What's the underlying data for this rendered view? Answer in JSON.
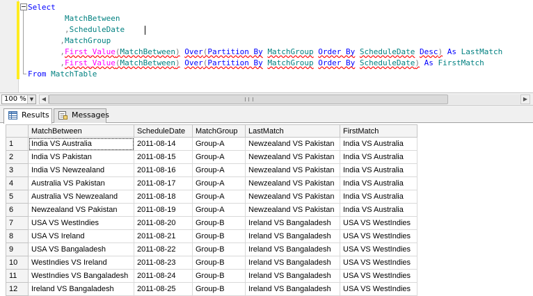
{
  "editor": {
    "lines": [
      [
        {
          "t": "Select",
          "c": "kw"
        }
      ],
      [
        {
          "t": "        "
        },
        {
          "t": "MatchBetween",
          "c": "id"
        }
      ],
      [
        {
          "t": "        "
        },
        {
          "t": ",",
          "c": "gray"
        },
        {
          "t": "ScheduleDate",
          "c": "id"
        }
      ],
      [
        {
          "t": "       "
        },
        {
          "t": ",",
          "c": "gray"
        },
        {
          "t": "MatchGroup",
          "c": "id"
        }
      ],
      [
        {
          "t": "       "
        },
        {
          "t": ",",
          "c": "gray"
        },
        {
          "t": "First_Value",
          "c": "fn sq"
        },
        {
          "t": "(",
          "c": "gray sq"
        },
        {
          "t": "MatchBetween",
          "c": "id sq"
        },
        {
          "t": ")",
          "c": "gray sq"
        },
        {
          "t": " "
        },
        {
          "t": "Over",
          "c": "kw sq"
        },
        {
          "t": "(",
          "c": "gray sq"
        },
        {
          "t": "Partition By",
          "c": "kw sq"
        },
        {
          "t": " "
        },
        {
          "t": "MatchGroup",
          "c": "id sq"
        },
        {
          "t": " "
        },
        {
          "t": "Order By",
          "c": "kw sq"
        },
        {
          "t": " "
        },
        {
          "t": "ScheduleDate",
          "c": "id sq"
        },
        {
          "t": " "
        },
        {
          "t": "Desc",
          "c": "kw sq"
        },
        {
          "t": ")",
          "c": "gray sq"
        },
        {
          "t": " "
        },
        {
          "t": "As",
          "c": "kw"
        },
        {
          "t": " "
        },
        {
          "t": "LastMatch",
          "c": "id"
        }
      ],
      [
        {
          "t": "       "
        },
        {
          "t": ",",
          "c": "gray"
        },
        {
          "t": "First_Value",
          "c": "fn sq"
        },
        {
          "t": "(",
          "c": "gray sq"
        },
        {
          "t": "MatchBetween",
          "c": "id sq"
        },
        {
          "t": ")",
          "c": "gray sq"
        },
        {
          "t": " "
        },
        {
          "t": "Over",
          "c": "kw sq"
        },
        {
          "t": "(",
          "c": "gray sq"
        },
        {
          "t": "Partition By",
          "c": "kw sq"
        },
        {
          "t": " "
        },
        {
          "t": "MatchGroup",
          "c": "id sq"
        },
        {
          "t": " "
        },
        {
          "t": "Order By",
          "c": "kw sq"
        },
        {
          "t": " "
        },
        {
          "t": "ScheduleDate",
          "c": "id sq"
        },
        {
          "t": ")",
          "c": "gray sq"
        },
        {
          "t": " "
        },
        {
          "t": "As",
          "c": "kw"
        },
        {
          "t": " "
        },
        {
          "t": "FirstMatch",
          "c": "id"
        }
      ],
      [
        {
          "t": "From",
          "c": "kw"
        },
        {
          "t": " "
        },
        {
          "t": "MatchTable",
          "c": "id"
        }
      ]
    ]
  },
  "zoom": {
    "value": "100 %"
  },
  "tabs": {
    "results": "Results",
    "messages": "Messages"
  },
  "grid": {
    "columns": [
      "",
      "MatchBetween",
      "ScheduleDate",
      "MatchGroup",
      "LastMatch",
      "FirstMatch"
    ],
    "rows": [
      [
        "1",
        "India VS Australia",
        "2011-08-14",
        "Group-A",
        "Newzealand VS Pakistan",
        "India VS Australia"
      ],
      [
        "2",
        "India VS Pakistan",
        "2011-08-15",
        "Group-A",
        "Newzealand VS Pakistan",
        "India VS Australia"
      ],
      [
        "3",
        "India VS Newzealand",
        "2011-08-16",
        "Group-A",
        "Newzealand VS Pakistan",
        "India VS Australia"
      ],
      [
        "4",
        "Australia VS Pakistan",
        "2011-08-17",
        "Group-A",
        "Newzealand VS Pakistan",
        "India VS Australia"
      ],
      [
        "5",
        "Australia VS Newzealand",
        "2011-08-18",
        "Group-A",
        "Newzealand VS Pakistan",
        "India VS Australia"
      ],
      [
        "6",
        "Newzealand VS Pakistan",
        "2011-08-19",
        "Group-A",
        "Newzealand VS Pakistan",
        "India VS Australia"
      ],
      [
        "7",
        "USA VS WestIndies",
        "2011-08-20",
        "Group-B",
        "Ireland VS Bangaladesh",
        "USA VS WestIndies"
      ],
      [
        "8",
        "USA VS Ireland",
        "2011-08-21",
        "Group-B",
        "Ireland VS Bangaladesh",
        "USA VS WestIndies"
      ],
      [
        "9",
        "USA VS Bangaladesh",
        "2011-08-22",
        "Group-B",
        "Ireland VS Bangaladesh",
        "USA VS WestIndies"
      ],
      [
        "10",
        "WestIndies VS Ireland",
        "2011-08-23",
        "Group-B",
        "Ireland VS Bangaladesh",
        "USA VS WestIndies"
      ],
      [
        "11",
        "WestIndies VS Bangaladesh",
        "2011-08-24",
        "Group-B",
        "Ireland VS Bangaladesh",
        "USA VS WestIndies"
      ],
      [
        "12",
        "Ireland VS Bangaladesh",
        "2011-08-25",
        "Group-B",
        "Ireland VS Bangaladesh",
        "USA VS WestIndies"
      ]
    ]
  }
}
